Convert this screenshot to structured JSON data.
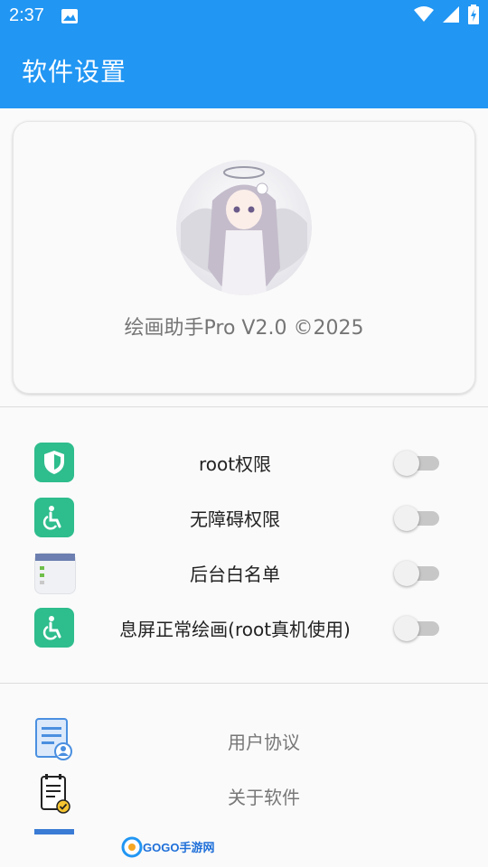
{
  "status_bar": {
    "time": "2:37"
  },
  "app_bar": {
    "title": "软件设置"
  },
  "profile_card": {
    "version_text": "绘画助手Pro V2.0 ©2025"
  },
  "permissions": [
    {
      "label": "root权限",
      "enabled": false
    },
    {
      "label": "无障碍权限",
      "enabled": false
    },
    {
      "label": "后台白名单",
      "enabled": false
    },
    {
      "label": "息屏正常绘画(root真机使用)",
      "enabled": false
    }
  ],
  "links": [
    {
      "label": "用户协议"
    },
    {
      "label": "关于软件"
    }
  ],
  "watermark": {
    "text": "GOGO手游网"
  },
  "colors": {
    "primary": "#2196f3",
    "icon_green": "#2ebd8c",
    "switch_track": "#c7c7c7"
  }
}
